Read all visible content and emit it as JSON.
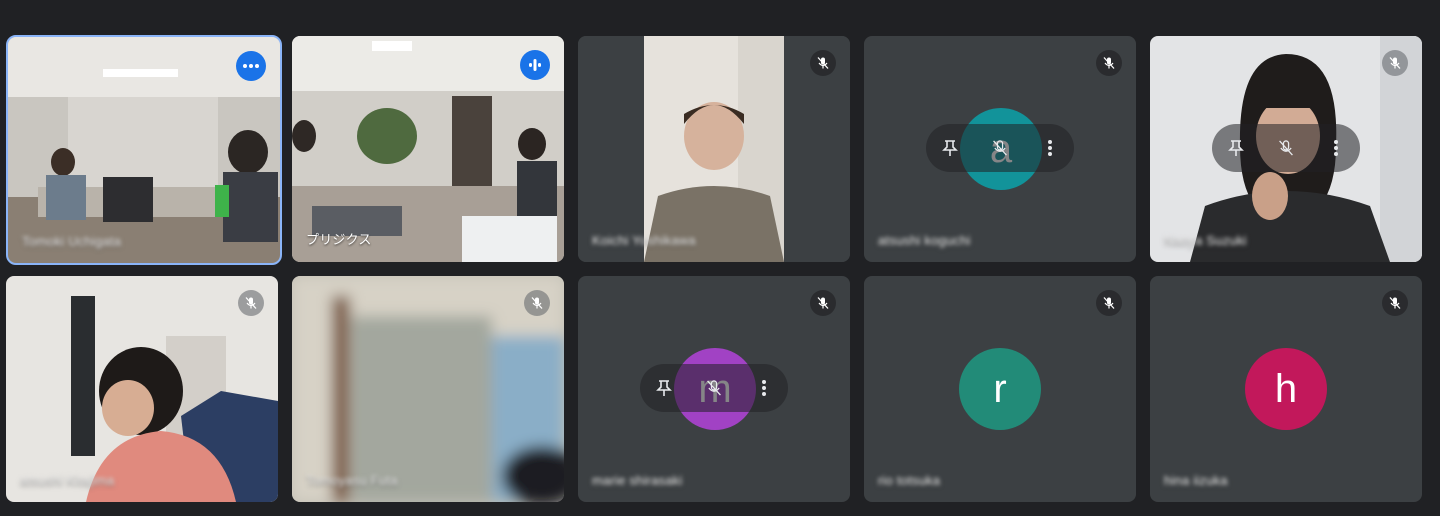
{
  "participants": [
    {
      "name": "Tomoki Uchigata",
      "muted": false,
      "badge": "more-options",
      "active": true
    },
    {
      "name": "プリジクス",
      "muted": false,
      "badge": "speaking"
    },
    {
      "name": "Koichi Yoshikawa",
      "muted": true
    },
    {
      "name": "atsushi koguchi",
      "muted": true,
      "avatar_letter": "a",
      "avatar_color": "#12939a"
    },
    {
      "name": "Naoya Suzuki",
      "muted": true
    },
    {
      "name": "atsushi Kitajima",
      "muted": true
    },
    {
      "name": "Tomoyasu Futa",
      "muted": true
    },
    {
      "name": "marie shirasaki",
      "muted": true,
      "avatar_letter": "m",
      "avatar_color": "#a142c4"
    },
    {
      "name": "rio totsuka",
      "muted": true,
      "avatar_letter": "r",
      "avatar_color": "#228b78"
    },
    {
      "name": "hina iizuka",
      "muted": true,
      "avatar_letter": "h",
      "avatar_color": "#c2185b"
    }
  ],
  "icons": {
    "mic_off": "mic-off-icon",
    "pin": "pin-icon",
    "more": "more-vert-icon",
    "speaking": "audio-level-icon"
  },
  "colors": {
    "background": "#202124",
    "tile": "#3c4043",
    "active_outline": "#8ab4f8",
    "badge": "#1a73e8"
  }
}
